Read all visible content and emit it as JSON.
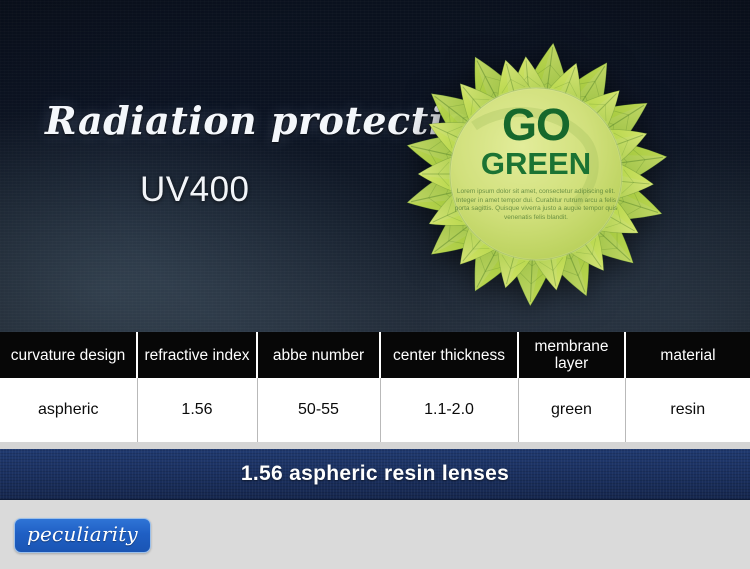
{
  "hero": {
    "script_title": "Radiation protection",
    "uv_title": "UV400",
    "background_top_color": "#0b1220",
    "background_bottom_color": "#232d3a"
  },
  "go_green_badge": {
    "headline_top": "GO",
    "headline_bottom": "GREEN",
    "body_text": "Lorem ipsum dolor sit amet, consectetur adipiscing elit. Integer in amet tempor dui. Curabitur rutrum arcu a felis porta sagittis. Quisque viverra justo a augue tempor quis venenatis felis blandit.",
    "leaf_color_light": "#b8d743",
    "leaf_color_dark": "#6ea82a",
    "circle_color": "#cfdf7a",
    "text_color": "#16682c"
  },
  "spec_table": {
    "headers": [
      "curvature design",
      "refractive index",
      "abbe number",
      "center thickness",
      "membrane layer",
      "material"
    ],
    "values": [
      "aspheric",
      "1.56",
      "50-55",
      "1.1-2.0",
      "green",
      "resin"
    ],
    "header_background": "#070707",
    "header_text_color": "#ffffff",
    "cell_background": "#ffffff",
    "cell_text_color": "#0b0b0b"
  },
  "banner": {
    "text": "1.56 aspheric resin lenses",
    "background_color": "#1b3161",
    "text_color": "#ffffff"
  },
  "footer": {
    "badge_label": "peculiarity",
    "badge_color": "#1f5fc4",
    "background_color": "#dadada"
  }
}
